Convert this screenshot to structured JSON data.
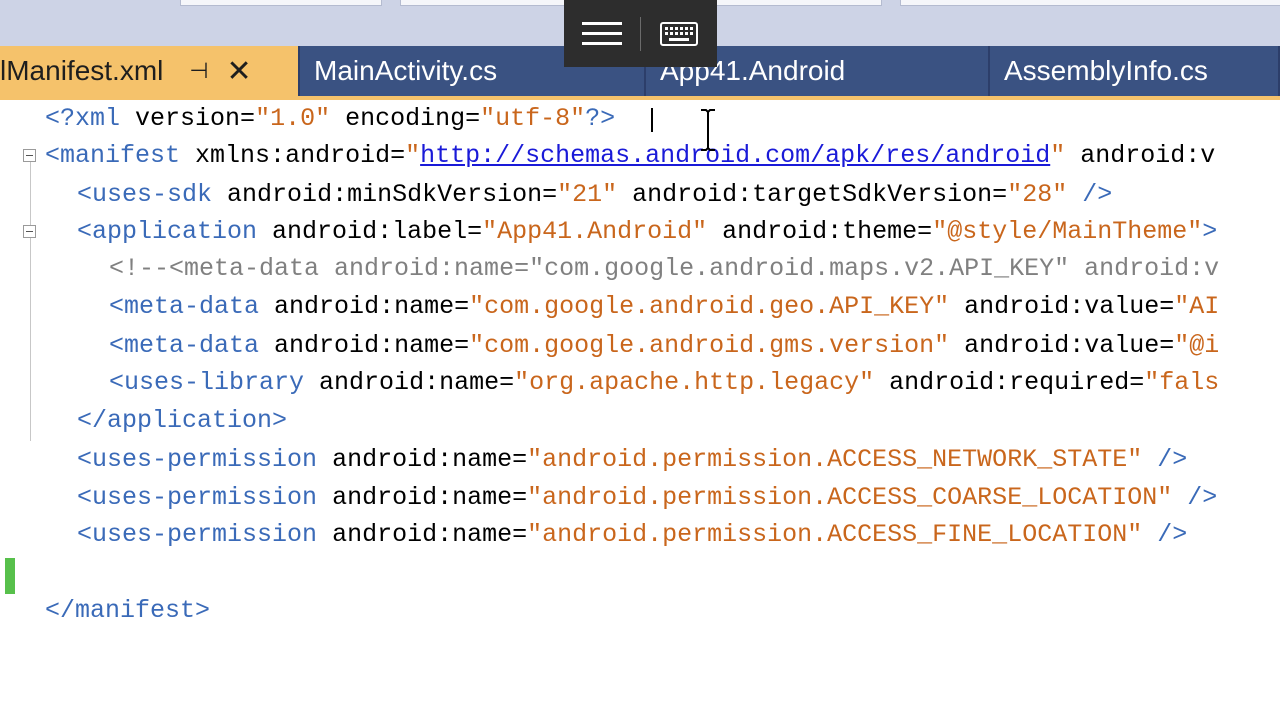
{
  "tabs": [
    {
      "label": "lManifest.xml",
      "active": true
    },
    {
      "label": "MainActivity.cs",
      "active": false
    },
    {
      "label": "App41.Android",
      "active": false
    },
    {
      "label": "AssemblyInfo.cs",
      "active": false
    }
  ],
  "tab_icons": {
    "pin": "pin-icon",
    "close": "close-icon"
  },
  "floating_toolbar": {
    "menu_icon": "hamburger-menu-icon",
    "keyboard_icon": "keyboard-icon"
  },
  "code": {
    "l1": {
      "open": "<?",
      "name": "xml",
      "a1": " version=",
      "v1": "\"1.0\"",
      "a2": " encoding=",
      "v2": "\"utf-8\"",
      "close": "?>"
    },
    "l2": {
      "open": "<",
      "name": "manifest",
      "a1": " xmlns:android=",
      "q1": "\"",
      "url": "http://schemas.android.com/apk/res/android",
      "q2": "\"",
      "a2": " android:v"
    },
    "l3": {
      "open": "<",
      "name": "uses-sdk",
      "a1": " android:minSdkVersion=",
      "v1": "\"21\"",
      "a2": " android:targetSdkVersion=",
      "v2": "\"28\"",
      "close": " />"
    },
    "l4": {
      "open": "<",
      "name": "application",
      "a1": " android:label=",
      "v1": "\"App41.Android\"",
      "a2": " android:theme=",
      "v2": "\"@style/MainTheme\"",
      "close": ">"
    },
    "l5": {
      "text": "<!--<meta-data android:name=\"com.google.android.maps.v2.API_KEY\" android:v"
    },
    "l6": {
      "open": "<",
      "name": "meta-data",
      "a1": " android:name=",
      "v1": "\"com.google.android.geo.API_KEY\"",
      "a2": " android:value=",
      "v2": "\"AI"
    },
    "l7": {
      "open": "<",
      "name": "meta-data",
      "a1": " android:name=",
      "v1": "\"com.google.android.gms.version\"",
      "a2": " android:value=",
      "v2": "\"@i"
    },
    "l8": {
      "open": "<",
      "name": "uses-library",
      "a1": " android:name=",
      "v1": "\"org.apache.http.legacy\"",
      "a2": " android:required=",
      "v2": "\"fals"
    },
    "l9": {
      "open": "</",
      "name": "application",
      "close": ">"
    },
    "l10": {
      "open": "<",
      "name": "uses-permission",
      "a1": " android:name=",
      "v1": "\"android.permission.ACCESS_NETWORK_STATE\"",
      "close": " />"
    },
    "l11": {
      "open": "<",
      "name": "uses-permission",
      "a1": " android:name=",
      "v1": "\"android.permission.ACCESS_COARSE_LOCATION\"",
      "close": " />"
    },
    "l12": {
      "open": "<",
      "name": "uses-permission",
      "a1": " android:name=",
      "v1": "\"android.permission.ACCESS_FINE_LOCATION\"",
      "close": " />"
    },
    "l14": {
      "open": "</",
      "name": "manifest",
      "close": ">"
    }
  },
  "colors": {
    "active_tab": "#f5c26b",
    "tab_bg": "#3a5282",
    "tag": "#3a6ab8",
    "string": "#c9661c",
    "link": "#1a1ad8",
    "comment": "#808080",
    "changed_line": "#57c04b"
  }
}
